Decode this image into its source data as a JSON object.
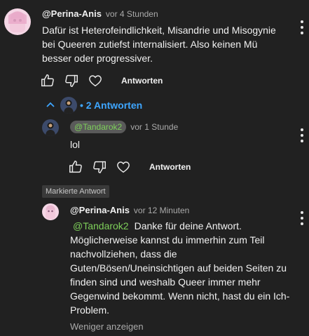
{
  "comment1": {
    "author": "@Perina-Anis",
    "time": "vor 4 Stunden",
    "text": "Dafür ist Heterofeindlichkeit, Misandrie und Misogynie bei Queeren zutiefst internalisiert. Also keinen Mü besser oder progressiver.",
    "reply_label": "Antworten"
  },
  "replies_toggle": {
    "label": "• 2 Antworten"
  },
  "reply1": {
    "mention": "@Tandarok2",
    "time": "vor 1 Stunde",
    "text": "lol",
    "reply_label": "Antworten"
  },
  "marked_badge": "Markierte Antwort",
  "reply2": {
    "author": "@Perina-Anis",
    "time": "vor 12 Minuten",
    "mention": "@Tandarok2",
    "text_after_mention": "Danke für deine Antwort.",
    "lines": [
      "Möglicherweise kannst du immerhin zum Teil",
      "nachvollziehen, dass die",
      "Guten/Bösen/Uneinsichtigen auf beiden Seiten zu",
      "finden sind und weshalb Queer immer mehr",
      "Gegenwind bekommt. Wenn nicht, hast du ein Ich-",
      "Problem."
    ],
    "less_label": "Weniger anzeigen"
  },
  "colors": {
    "background": "#212121",
    "link_blue": "#3ea6ff",
    "mention_green": "#7ed05a"
  }
}
